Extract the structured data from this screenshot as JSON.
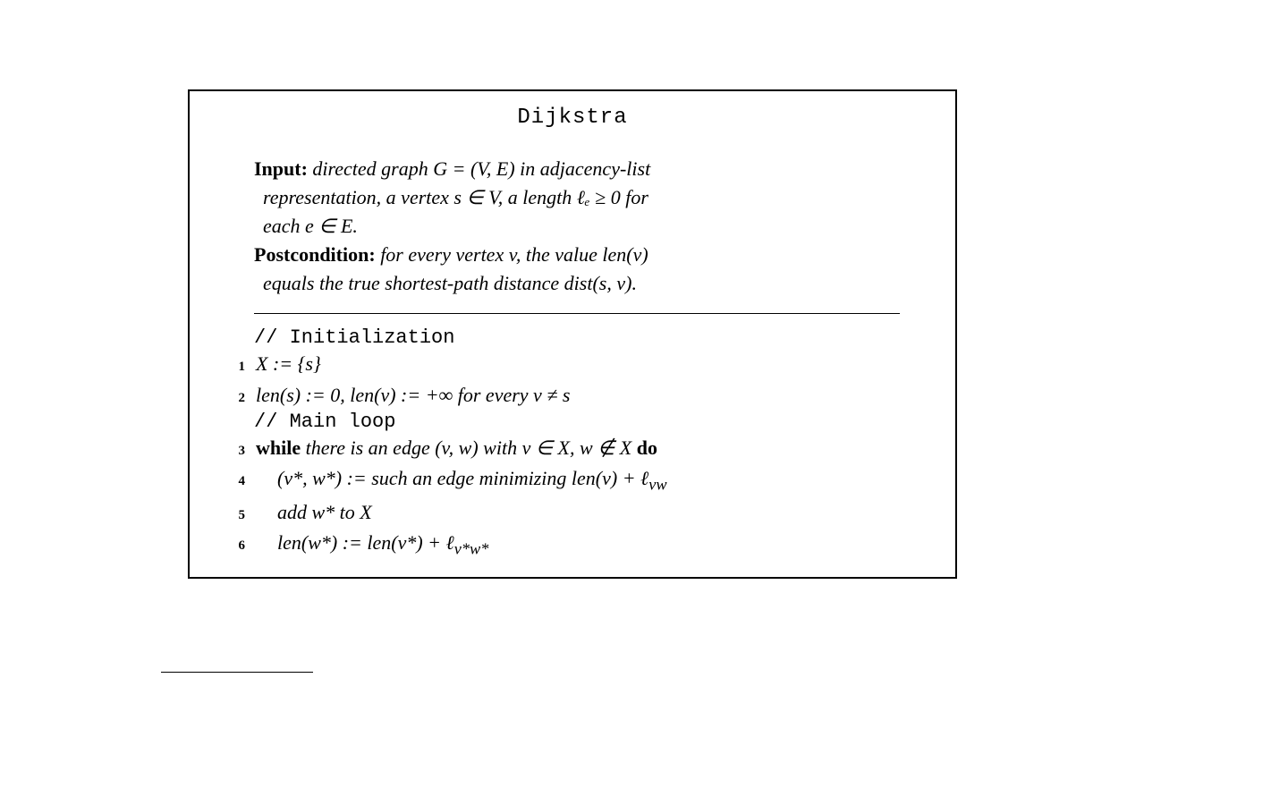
{
  "title": "Dijkstra",
  "spec": {
    "input_label": "Input:",
    "input_line1": " directed graph G = (V, E) in adjacency-list",
    "input_line2": "representation, a vertex s ∈ V, a length ℓₑ ≥ 0 for",
    "input_line3": "each e ∈ E.",
    "post_label": "Postcondition:",
    "post_line1": " for every vertex v, the value len(v)",
    "post_line2": "equals the true shortest-path distance dist(s, v)."
  },
  "comments": {
    "init": "// Initialization",
    "main": "// Main loop"
  },
  "lines": {
    "n1": "1",
    "l1": "X := {s}",
    "n2": "2",
    "l2": "len(s) := 0, len(v) := +∞ for every v ≠ s",
    "n3": "3",
    "l3_kw": "while",
    "l3_mid": " there is an edge (v, w) with v ∈ X, w ∉ X ",
    "l3_do": "do",
    "n4": "4",
    "l4": "(v*, w*) := such an edge minimizing len(v) + ℓᵥᵥᵥ",
    "l4_a": "(v*, w*) := such an edge minimizing ",
    "l4_b": "len(v) + ℓ",
    "l4_sub": "vw",
    "n5": "5",
    "l5": "add w* to X",
    "n6": "6",
    "l6_a": "len(w*) := len(v*) + ℓ",
    "l6_sub": "v*w*"
  }
}
